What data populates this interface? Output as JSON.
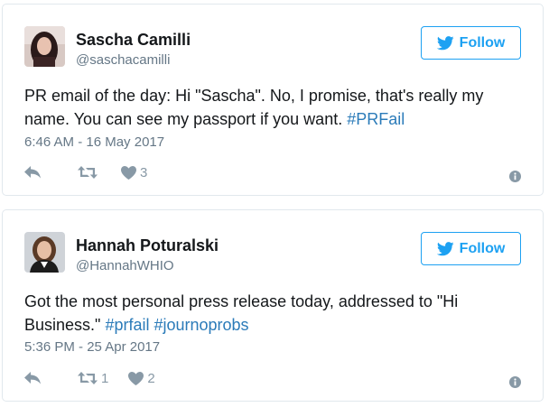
{
  "tweets": [
    {
      "user": {
        "name": "Sascha Camilli",
        "handle": "@saschacamilli"
      },
      "follow_label": "Follow",
      "text_plain": "PR email of the day: Hi \"Sascha\". No, I promise, that's really my name. You can see my passport if you want. ",
      "hashtags": [
        "#PRFail"
      ],
      "timestamp": "6:46 AM - 16 May 2017",
      "retweets": "",
      "likes": "3"
    },
    {
      "user": {
        "name": "Hannah Poturalski",
        "handle": "@HannahWHIO"
      },
      "follow_label": "Follow",
      "text_plain": "Got the most personal press release today, addressed to \"Hi Business.\" ",
      "hashtags": [
        "#prfail",
        "#journoprobs"
      ],
      "timestamp": "5:36 PM - 25 Apr 2017",
      "retweets": "1",
      "likes": "2"
    }
  ],
  "colors": {
    "accent": "#1da1f2",
    "hashtag": "#2b7bb9",
    "muted": "#657786",
    "icon": "#8899a6"
  },
  "icons": [
    "twitter-bird-icon",
    "reply-icon",
    "retweet-icon",
    "heart-icon",
    "info-icon"
  ]
}
